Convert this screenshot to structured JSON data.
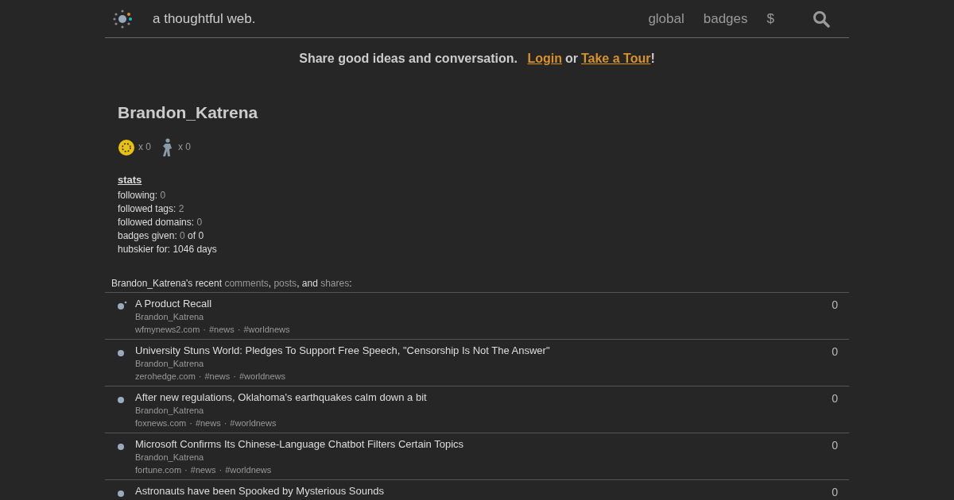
{
  "header": {
    "tagline": "a thoughtful web.",
    "nav": [
      "global",
      "badges",
      "$"
    ]
  },
  "banner": {
    "text": "Share good ideas and conversation.",
    "login": "Login",
    "or": "or",
    "tour": "Take a Tour",
    "end": "!"
  },
  "profile": {
    "username": "Brandon_Katrena",
    "badges": [
      {
        "kind": "gold",
        "count": "x 0"
      },
      {
        "kind": "walker",
        "count": "x 0"
      }
    ],
    "stats_title": "stats",
    "stats": [
      {
        "label": "following:",
        "parts": [
          {
            "text": "0",
            "muted": true
          }
        ]
      },
      {
        "label": "followed tags:",
        "parts": [
          {
            "text": "2",
            "muted": true
          }
        ]
      },
      {
        "label": "followed domains:",
        "parts": [
          {
            "text": "0",
            "muted": true
          }
        ]
      },
      {
        "label": "badges given:",
        "parts": [
          {
            "text": "0",
            "muted": true
          },
          {
            "text": "of 0",
            "muted": false
          }
        ]
      },
      {
        "label": "hubskier for:",
        "parts": [
          {
            "text": "1046 days",
            "muted": false
          }
        ]
      }
    ]
  },
  "recent": {
    "owner": "Brandon_Katrena's recent",
    "links": [
      "comments",
      "posts",
      "shares"
    ],
    "sep1": ",",
    "sep2": ", and",
    "end": ":"
  },
  "posts": [
    {
      "kind": "share",
      "title": "A Product Recall",
      "author": "Brandon_Katrena",
      "domain": "wfmynews2.com",
      "separators": [
        "·",
        "·"
      ],
      "tags": [
        "#news",
        "#worldnews"
      ],
      "score": "0"
    },
    {
      "kind": "post",
      "title": "University Stuns World: Pledges To Support Free Speech, \"Censorship Is Not The Answer\"",
      "author": "Brandon_Katrena",
      "domain": "zerohedge.com",
      "separators": [
        "·",
        "·"
      ],
      "tags": [
        "#news",
        "#worldnews"
      ],
      "score": "0"
    },
    {
      "kind": "post",
      "title": "After new regulations, Oklahoma's earthquakes calm down a bit",
      "author": "Brandon_Katrena",
      "domain": "foxnews.com",
      "separators": [
        "·",
        "·"
      ],
      "tags": [
        "#news",
        "#worldnews"
      ],
      "score": "0"
    },
    {
      "kind": "post",
      "title": "Microsoft Confirms Its Chinese-Language Chatbot Filters Certain Topics",
      "author": "Brandon_Katrena",
      "domain": "fortune.com",
      "separators": [
        "·",
        "·"
      ],
      "tags": [
        "#news",
        "#worldnews"
      ],
      "score": "0"
    },
    {
      "kind": "post",
      "title": "Astronauts have been Spooked by Mysterious Sounds",
      "score": "0"
    }
  ]
}
